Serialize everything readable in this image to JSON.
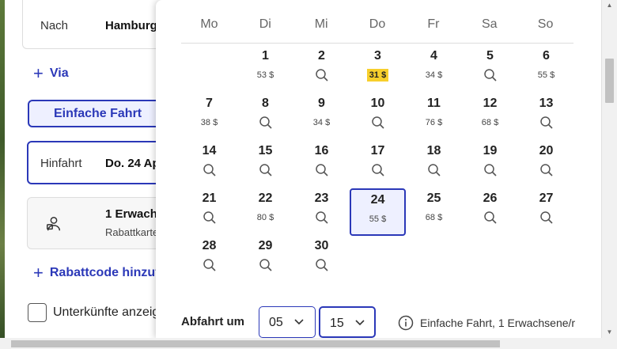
{
  "form": {
    "to_label": "Nach",
    "to_value": "Hamburg",
    "via_label": "Via",
    "trip_type_label": "Einfache Fahrt",
    "outbound_label": "Hinfahrt",
    "outbound_value": "Do. 24 Ap",
    "passengers_title": "1 Erwach",
    "passengers_sub": "Rabattkarte",
    "discount_label": "Rabattcode hinzufü",
    "accommodation_label": "Unterkünfte anzeige"
  },
  "calendar": {
    "weekdays": [
      "Mo",
      "Di",
      "Mi",
      "Do",
      "Fr",
      "Sa",
      "So"
    ],
    "days": [
      {
        "day": "1",
        "col": 1,
        "row": 0,
        "price": "53 $"
      },
      {
        "day": "2",
        "col": 2,
        "row": 0,
        "price": ""
      },
      {
        "day": "3",
        "col": 3,
        "row": 0,
        "price": "31 $",
        "cheapest": true
      },
      {
        "day": "4",
        "col": 4,
        "row": 0,
        "price": "34 $"
      },
      {
        "day": "5",
        "col": 5,
        "row": 0,
        "price": ""
      },
      {
        "day": "6",
        "col": 6,
        "row": 0,
        "price": "55 $"
      },
      {
        "day": "7",
        "col": 0,
        "row": 1,
        "price": "38 $"
      },
      {
        "day": "8",
        "col": 1,
        "row": 1,
        "price": ""
      },
      {
        "day": "9",
        "col": 2,
        "row": 1,
        "price": "34 $"
      },
      {
        "day": "10",
        "col": 3,
        "row": 1,
        "price": ""
      },
      {
        "day": "11",
        "col": 4,
        "row": 1,
        "price": "76 $"
      },
      {
        "day": "12",
        "col": 5,
        "row": 1,
        "price": "68 $"
      },
      {
        "day": "13",
        "col": 6,
        "row": 1,
        "price": ""
      },
      {
        "day": "14",
        "col": 0,
        "row": 2,
        "price": ""
      },
      {
        "day": "15",
        "col": 1,
        "row": 2,
        "price": ""
      },
      {
        "day": "16",
        "col": 2,
        "row": 2,
        "price": ""
      },
      {
        "day": "17",
        "col": 3,
        "row": 2,
        "price": ""
      },
      {
        "day": "18",
        "col": 4,
        "row": 2,
        "price": ""
      },
      {
        "day": "19",
        "col": 5,
        "row": 2,
        "price": ""
      },
      {
        "day": "20",
        "col": 6,
        "row": 2,
        "price": ""
      },
      {
        "day": "21",
        "col": 0,
        "row": 3,
        "price": ""
      },
      {
        "day": "22",
        "col": 1,
        "row": 3,
        "price": "80 $"
      },
      {
        "day": "23",
        "col": 2,
        "row": 3,
        "price": ""
      },
      {
        "day": "24",
        "col": 3,
        "row": 3,
        "price": "55 $",
        "selected": true
      },
      {
        "day": "25",
        "col": 4,
        "row": 3,
        "price": "68 $"
      },
      {
        "day": "26",
        "col": 5,
        "row": 3,
        "price": ""
      },
      {
        "day": "27",
        "col": 6,
        "row": 3,
        "price": ""
      },
      {
        "day": "28",
        "col": 0,
        "row": 4,
        "price": ""
      },
      {
        "day": "29",
        "col": 1,
        "row": 4,
        "price": ""
      },
      {
        "day": "30",
        "col": 2,
        "row": 4,
        "price": ""
      }
    ],
    "departure_label": "Abfahrt um",
    "hour_value": "05",
    "minute_value": "15",
    "info_text": "Einfache Fahrt, 1 Erwachsene/r"
  },
  "colors": {
    "accent": "#2b38b8",
    "cheapest_highlight": "#f7cf2c",
    "selected_bg": "#eef0ff"
  },
  "icons": {
    "search": "magnifier-icon",
    "plus": "plus-icon",
    "chevron": "chevron-down-icon",
    "info": "info-icon",
    "passenger": "passenger-icon"
  }
}
